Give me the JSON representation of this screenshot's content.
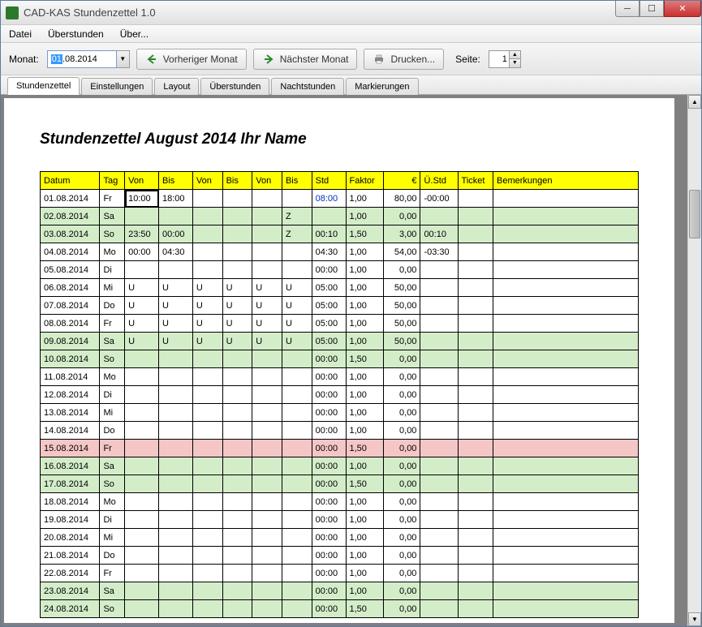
{
  "window": {
    "title": "CAD-KAS Stundenzettel 1.0"
  },
  "menu": {
    "items": [
      "Datei",
      "Überstunden",
      "Über..."
    ]
  },
  "toolbar": {
    "month_label": "Monat:",
    "date_value_prefix": "01",
    "date_value_suffix": ".08.2014",
    "prev_month": "Vorheriger Monat",
    "next_month": "Nächster Monat",
    "print": "Drucken...",
    "page_label": "Seite:",
    "page_value": "1"
  },
  "tabs": [
    "Stundenzettel",
    "Einstellungen",
    "Layout",
    "Überstunden",
    "Nachtstunden",
    "Markierungen"
  ],
  "page_title": "Stundenzettel August 2014 Ihr Name",
  "headers": [
    "Datum",
    "Tag",
    "Von",
    "Bis",
    "Von",
    "Bis",
    "Von",
    "Bis",
    "Std",
    "Faktor",
    "€",
    "Ü.Std",
    "Ticket",
    "Bemerkungen"
  ],
  "rows": [
    {
      "date": "01.08.2014",
      "tag": "Fr",
      "v1": "10:00",
      "b1": "18:00",
      "v2": "",
      "b2": "",
      "v3": "",
      "b3": "",
      "std": "08:00",
      "fak": "1,00",
      "eur": "80,00",
      "ustd": "-00:00",
      "ticket": "",
      "bem": "",
      "cls": "",
      "blue": true,
      "sel": true
    },
    {
      "date": "02.08.2014",
      "tag": "Sa",
      "v1": "",
      "b1": "",
      "v2": "",
      "b2": "",
      "v3": "",
      "b3": "Z",
      "std": "",
      "fak": "1,00",
      "eur": "0,00",
      "ustd": "",
      "ticket": "",
      "bem": "",
      "cls": "green"
    },
    {
      "date": "03.08.2014",
      "tag": "So",
      "v1": "23:50",
      "b1": "00:00",
      "v2": "",
      "b2": "",
      "v3": "",
      "b3": "Z",
      "std": "00:10",
      "fak": "1,50",
      "eur": "3,00",
      "ustd": "00:10",
      "ticket": "",
      "bem": "",
      "cls": "green"
    },
    {
      "date": "04.08.2014",
      "tag": "Mo",
      "v1": "00:00",
      "b1": "04:30",
      "v2": "",
      "b2": "",
      "v3": "",
      "b3": "",
      "std": "04:30",
      "fak": "1,00",
      "eur": "54,00",
      "ustd": "-03:30",
      "ticket": "",
      "bem": "",
      "cls": ""
    },
    {
      "date": "05.08.2014",
      "tag": "Di",
      "v1": "",
      "b1": "",
      "v2": "",
      "b2": "",
      "v3": "",
      "b3": "",
      "std": "00:00",
      "fak": "1,00",
      "eur": "0,00",
      "ustd": "",
      "ticket": "",
      "bem": "",
      "cls": ""
    },
    {
      "date": "06.08.2014",
      "tag": "Mi",
      "v1": "U",
      "b1": "U",
      "v2": "U",
      "b2": "U",
      "v3": "U",
      "b3": "U",
      "std": "05:00",
      "fak": "1,00",
      "eur": "50,00",
      "ustd": "",
      "ticket": "",
      "bem": "",
      "cls": ""
    },
    {
      "date": "07.08.2014",
      "tag": "Do",
      "v1": "U",
      "b1": "U",
      "v2": "U",
      "b2": "U",
      "v3": "U",
      "b3": "U",
      "std": "05:00",
      "fak": "1,00",
      "eur": "50,00",
      "ustd": "",
      "ticket": "",
      "bem": "",
      "cls": ""
    },
    {
      "date": "08.08.2014",
      "tag": "Fr",
      "v1": "U",
      "b1": "U",
      "v2": "U",
      "b2": "U",
      "v3": "U",
      "b3": "U",
      "std": "05:00",
      "fak": "1,00",
      "eur": "50,00",
      "ustd": "",
      "ticket": "",
      "bem": "",
      "cls": ""
    },
    {
      "date": "09.08.2014",
      "tag": "Sa",
      "v1": "U",
      "b1": "U",
      "v2": "U",
      "b2": "U",
      "v3": "U",
      "b3": "U",
      "std": "05:00",
      "fak": "1,00",
      "eur": "50,00",
      "ustd": "",
      "ticket": "",
      "bem": "",
      "cls": "green"
    },
    {
      "date": "10.08.2014",
      "tag": "So",
      "v1": "",
      "b1": "",
      "v2": "",
      "b2": "",
      "v3": "",
      "b3": "",
      "std": "00:00",
      "fak": "1,50",
      "eur": "0,00",
      "ustd": "",
      "ticket": "",
      "bem": "",
      "cls": "green"
    },
    {
      "date": "11.08.2014",
      "tag": "Mo",
      "v1": "",
      "b1": "",
      "v2": "",
      "b2": "",
      "v3": "",
      "b3": "",
      "std": "00:00",
      "fak": "1,00",
      "eur": "0,00",
      "ustd": "",
      "ticket": "",
      "bem": "",
      "cls": ""
    },
    {
      "date": "12.08.2014",
      "tag": "Di",
      "v1": "",
      "b1": "",
      "v2": "",
      "b2": "",
      "v3": "",
      "b3": "",
      "std": "00:00",
      "fak": "1,00",
      "eur": "0,00",
      "ustd": "",
      "ticket": "",
      "bem": "",
      "cls": ""
    },
    {
      "date": "13.08.2014",
      "tag": "Mi",
      "v1": "",
      "b1": "",
      "v2": "",
      "b2": "",
      "v3": "",
      "b3": "",
      "std": "00:00",
      "fak": "1,00",
      "eur": "0,00",
      "ustd": "",
      "ticket": "",
      "bem": "",
      "cls": ""
    },
    {
      "date": "14.08.2014",
      "tag": "Do",
      "v1": "",
      "b1": "",
      "v2": "",
      "b2": "",
      "v3": "",
      "b3": "",
      "std": "00:00",
      "fak": "1,00",
      "eur": "0,00",
      "ustd": "",
      "ticket": "",
      "bem": "",
      "cls": ""
    },
    {
      "date": "15.08.2014",
      "tag": "Fr",
      "v1": "",
      "b1": "",
      "v2": "",
      "b2": "",
      "v3": "",
      "b3": "",
      "std": "00:00",
      "fak": "1,50",
      "eur": "0,00",
      "ustd": "",
      "ticket": "",
      "bem": "",
      "cls": "pink"
    },
    {
      "date": "16.08.2014",
      "tag": "Sa",
      "v1": "",
      "b1": "",
      "v2": "",
      "b2": "",
      "v3": "",
      "b3": "",
      "std": "00:00",
      "fak": "1,00",
      "eur": "0,00",
      "ustd": "",
      "ticket": "",
      "bem": "",
      "cls": "green"
    },
    {
      "date": "17.08.2014",
      "tag": "So",
      "v1": "",
      "b1": "",
      "v2": "",
      "b2": "",
      "v3": "",
      "b3": "",
      "std": "00:00",
      "fak": "1,50",
      "eur": "0,00",
      "ustd": "",
      "ticket": "",
      "bem": "",
      "cls": "green"
    },
    {
      "date": "18.08.2014",
      "tag": "Mo",
      "v1": "",
      "b1": "",
      "v2": "",
      "b2": "",
      "v3": "",
      "b3": "",
      "std": "00:00",
      "fak": "1,00",
      "eur": "0,00",
      "ustd": "",
      "ticket": "",
      "bem": "",
      "cls": ""
    },
    {
      "date": "19.08.2014",
      "tag": "Di",
      "v1": "",
      "b1": "",
      "v2": "",
      "b2": "",
      "v3": "",
      "b3": "",
      "std": "00:00",
      "fak": "1,00",
      "eur": "0,00",
      "ustd": "",
      "ticket": "",
      "bem": "",
      "cls": ""
    },
    {
      "date": "20.08.2014",
      "tag": "Mi",
      "v1": "",
      "b1": "",
      "v2": "",
      "b2": "",
      "v3": "",
      "b3": "",
      "std": "00:00",
      "fak": "1,00",
      "eur": "0,00",
      "ustd": "",
      "ticket": "",
      "bem": "",
      "cls": ""
    },
    {
      "date": "21.08.2014",
      "tag": "Do",
      "v1": "",
      "b1": "",
      "v2": "",
      "b2": "",
      "v3": "",
      "b3": "",
      "std": "00:00",
      "fak": "1,00",
      "eur": "0,00",
      "ustd": "",
      "ticket": "",
      "bem": "",
      "cls": ""
    },
    {
      "date": "22.08.2014",
      "tag": "Fr",
      "v1": "",
      "b1": "",
      "v2": "",
      "b2": "",
      "v3": "",
      "b3": "",
      "std": "00:00",
      "fak": "1,00",
      "eur": "0,00",
      "ustd": "",
      "ticket": "",
      "bem": "",
      "cls": ""
    },
    {
      "date": "23.08.2014",
      "tag": "Sa",
      "v1": "",
      "b1": "",
      "v2": "",
      "b2": "",
      "v3": "",
      "b3": "",
      "std": "00:00",
      "fak": "1,00",
      "eur": "0,00",
      "ustd": "",
      "ticket": "",
      "bem": "",
      "cls": "green"
    },
    {
      "date": "24.08.2014",
      "tag": "So",
      "v1": "",
      "b1": "",
      "v2": "",
      "b2": "",
      "v3": "",
      "b3": "",
      "std": "00:00",
      "fak": "1,50",
      "eur": "0,00",
      "ustd": "",
      "ticket": "",
      "bem": "",
      "cls": "green"
    }
  ]
}
